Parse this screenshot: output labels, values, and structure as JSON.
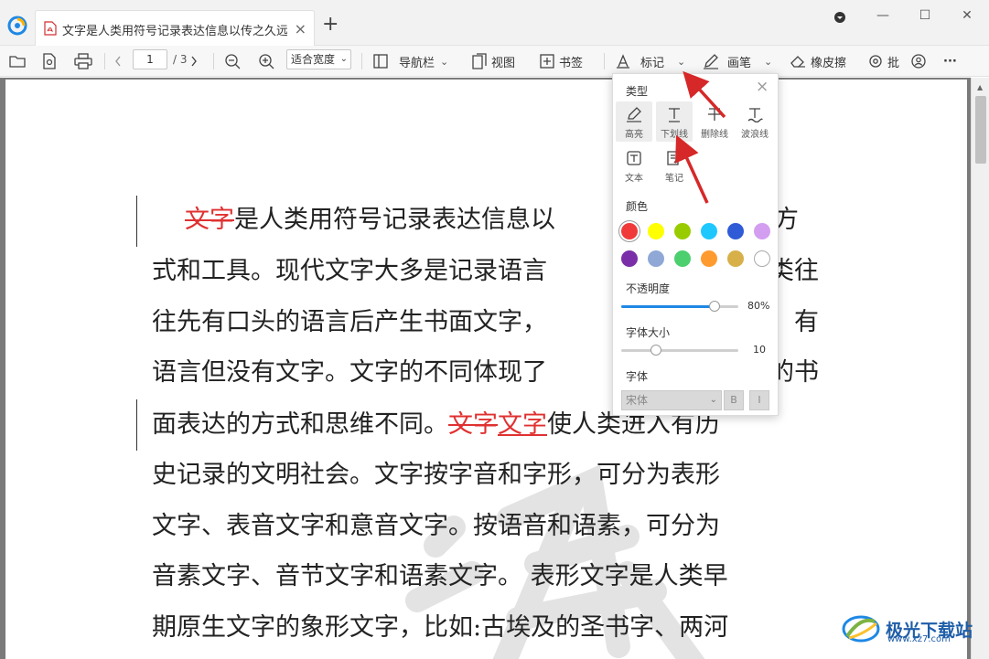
{
  "titlebar": {
    "tab_title": "文字是人类用符号记录表达信息以传之久远...",
    "tab_close": "×",
    "new_tab": "+",
    "minimize": "—",
    "maximize": "☐",
    "close": "✕"
  },
  "toolbar": {
    "page_current": "1",
    "page_total": "/ 3",
    "zoom_value": "适合宽度",
    "nav_label": "导航栏",
    "view_label": "视图",
    "bookmark_label": "书签",
    "mark_label": "标记",
    "pen_label": "画笔",
    "eraser_label": "橡皮擦",
    "annotate_label": "批",
    "more_label": "···"
  },
  "document": {
    "lines": [
      {
        "pre": "",
        "strike": "文字",
        "underline": "",
        "post": "是人类用符号记录表达信息以",
        "tail": "方"
      },
      {
        "pre": "式和工具。现代文字大多是记录语言",
        "strike": "",
        "underline": "",
        "post": "",
        "tail": "类往"
      },
      {
        "pre": "往先有口头的语言后产生书面文字，",
        "strike": "",
        "underline": "",
        "post": "",
        "tail": "有"
      },
      {
        "pre": "语言但没有文字。文字的不同体现了",
        "strike": "",
        "underline": "",
        "post": "",
        "tail": "的书"
      },
      {
        "pre": "面表达的方式和思维不同。",
        "strike": "文字",
        "underline": "文字",
        "post": "使人类进入有历",
        "tail": ""
      },
      {
        "pre": "史记录的文明社会。文字按字音和字形，可分为表形",
        "strike": "",
        "underline": "",
        "post": "",
        "tail": ""
      },
      {
        "pre": "文字、表音文字和意音文字。按语音和语素，可分为",
        "strike": "",
        "underline": "",
        "post": "",
        "tail": ""
      },
      {
        "pre": "音素文字、音节文字和语素文字。 表形文字是人类早",
        "strike": "",
        "underline": "",
        "post": "",
        "tail": ""
      },
      {
        "pre": "期原生文字的象形文字，比如:古埃及的圣书字、两河",
        "strike": "",
        "underline": "",
        "post": "",
        "tail": ""
      }
    ]
  },
  "panel": {
    "type_title": "类型",
    "close": "×",
    "tools": [
      {
        "label": "高亮",
        "icon": "highlight-icon"
      },
      {
        "label": "下划线",
        "icon": "underline-icon"
      },
      {
        "label": "删除线",
        "icon": "strikethrough-icon"
      },
      {
        "label": "波浪线",
        "icon": "wavy-line-icon"
      },
      {
        "label": "文本",
        "icon": "text-box-icon"
      },
      {
        "label": "笔记",
        "icon": "note-icon"
      }
    ],
    "color_title": "颜色",
    "colors": [
      "#f03a3a",
      "#ffff00",
      "#99cc00",
      "#1ec8ff",
      "#2f5bd6",
      "#d39ef0",
      "#7a2fa8",
      "#8fa8d6",
      "#4ccf6f",
      "#ff9a2e",
      "#d8b04a",
      "#ffffff"
    ],
    "selected_color": "#f03a3a",
    "opacity_title": "不透明度",
    "opacity_value": "80%",
    "opacity_fraction": 0.8,
    "fontsize_title": "字体大小",
    "fontsize_value": "10",
    "fontsize_fraction": 0.3,
    "font_title": "字体",
    "font_value": "宋体",
    "bold_label": "B",
    "italic_label": "I"
  },
  "brand": {
    "name": "极光下载站",
    "url": "www.xz7.com"
  }
}
